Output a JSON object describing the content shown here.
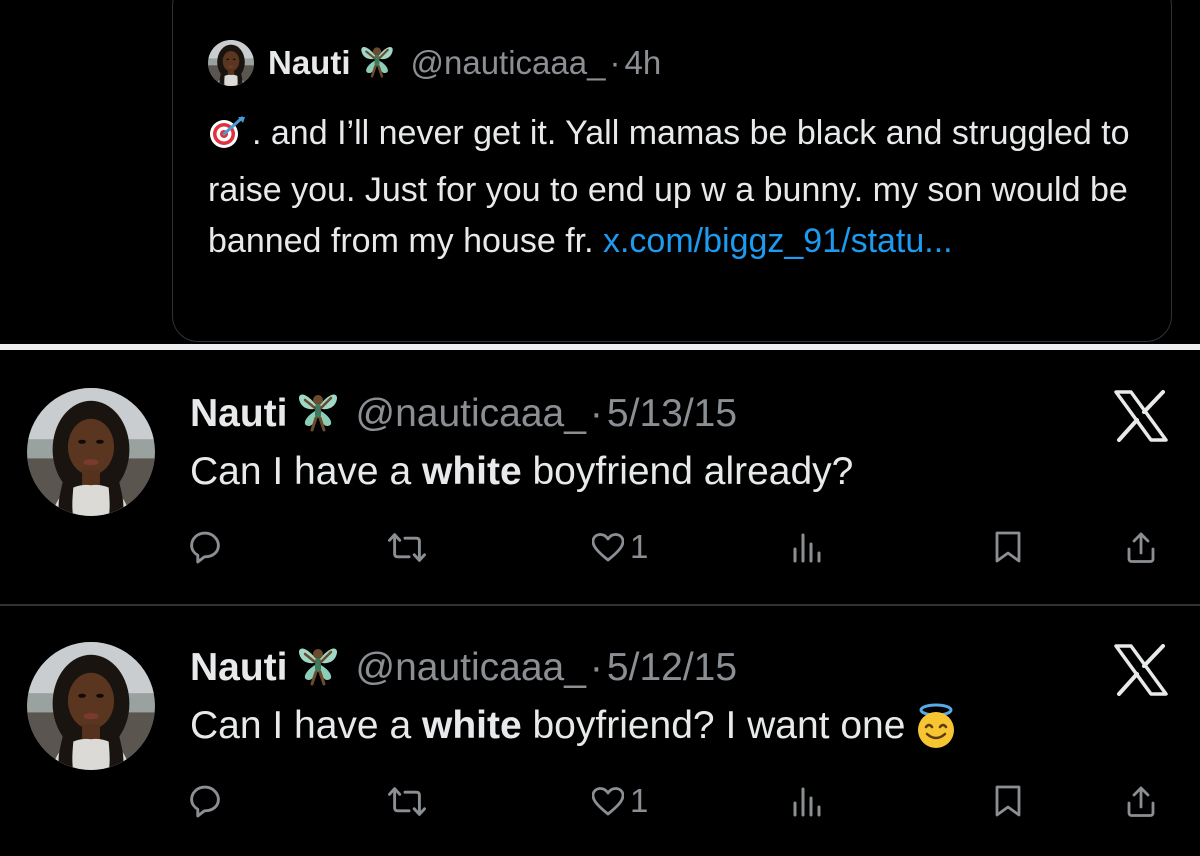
{
  "quoted_tweet": {
    "name": "Nauti",
    "name_emoji": "fairy-emoji",
    "handle": "@nauticaaa_",
    "separator": "·",
    "time": "4h",
    "text_emoji": "direct-hit-emoji",
    "text_main": ". and I’ll never get it. Yall mamas be black and struggled to raise you. Just for you to end up w a bunny. my son would be banned from my house fr. ",
    "link": "x.com/biggz_91/statu..."
  },
  "tweets": [
    {
      "name": "Nauti",
      "name_emoji": "fairy-emoji",
      "handle": "@nauticaaa_",
      "separator": "·",
      "date": "5/13/15",
      "text_before": "Can I have a ",
      "text_bold": "white",
      "text_after": " boyfriend already?",
      "trailing_emoji": "",
      "like_count": "1"
    },
    {
      "name": "Nauti",
      "name_emoji": "fairy-emoji",
      "handle": "@nauticaaa_",
      "separator": "·",
      "date": "5/12/15",
      "text_before": "Can I have a ",
      "text_bold": "white",
      "text_after": " boyfriend? I want one",
      "trailing_emoji": "smiling-face-with-halo-emoji",
      "like_count": "1"
    }
  ],
  "icons": {
    "reply": "reply-icon",
    "retweet": "retweet-icon",
    "like": "heart-icon",
    "views": "views-icon",
    "bookmark": "bookmark-icon",
    "share": "share-icon",
    "platform": "x-logo-icon"
  },
  "colors": {
    "background": "#000000",
    "text": "#e7e9ea",
    "secondary": "#8b8f94",
    "link": "#1d9bf0",
    "border": "#2f3336"
  }
}
